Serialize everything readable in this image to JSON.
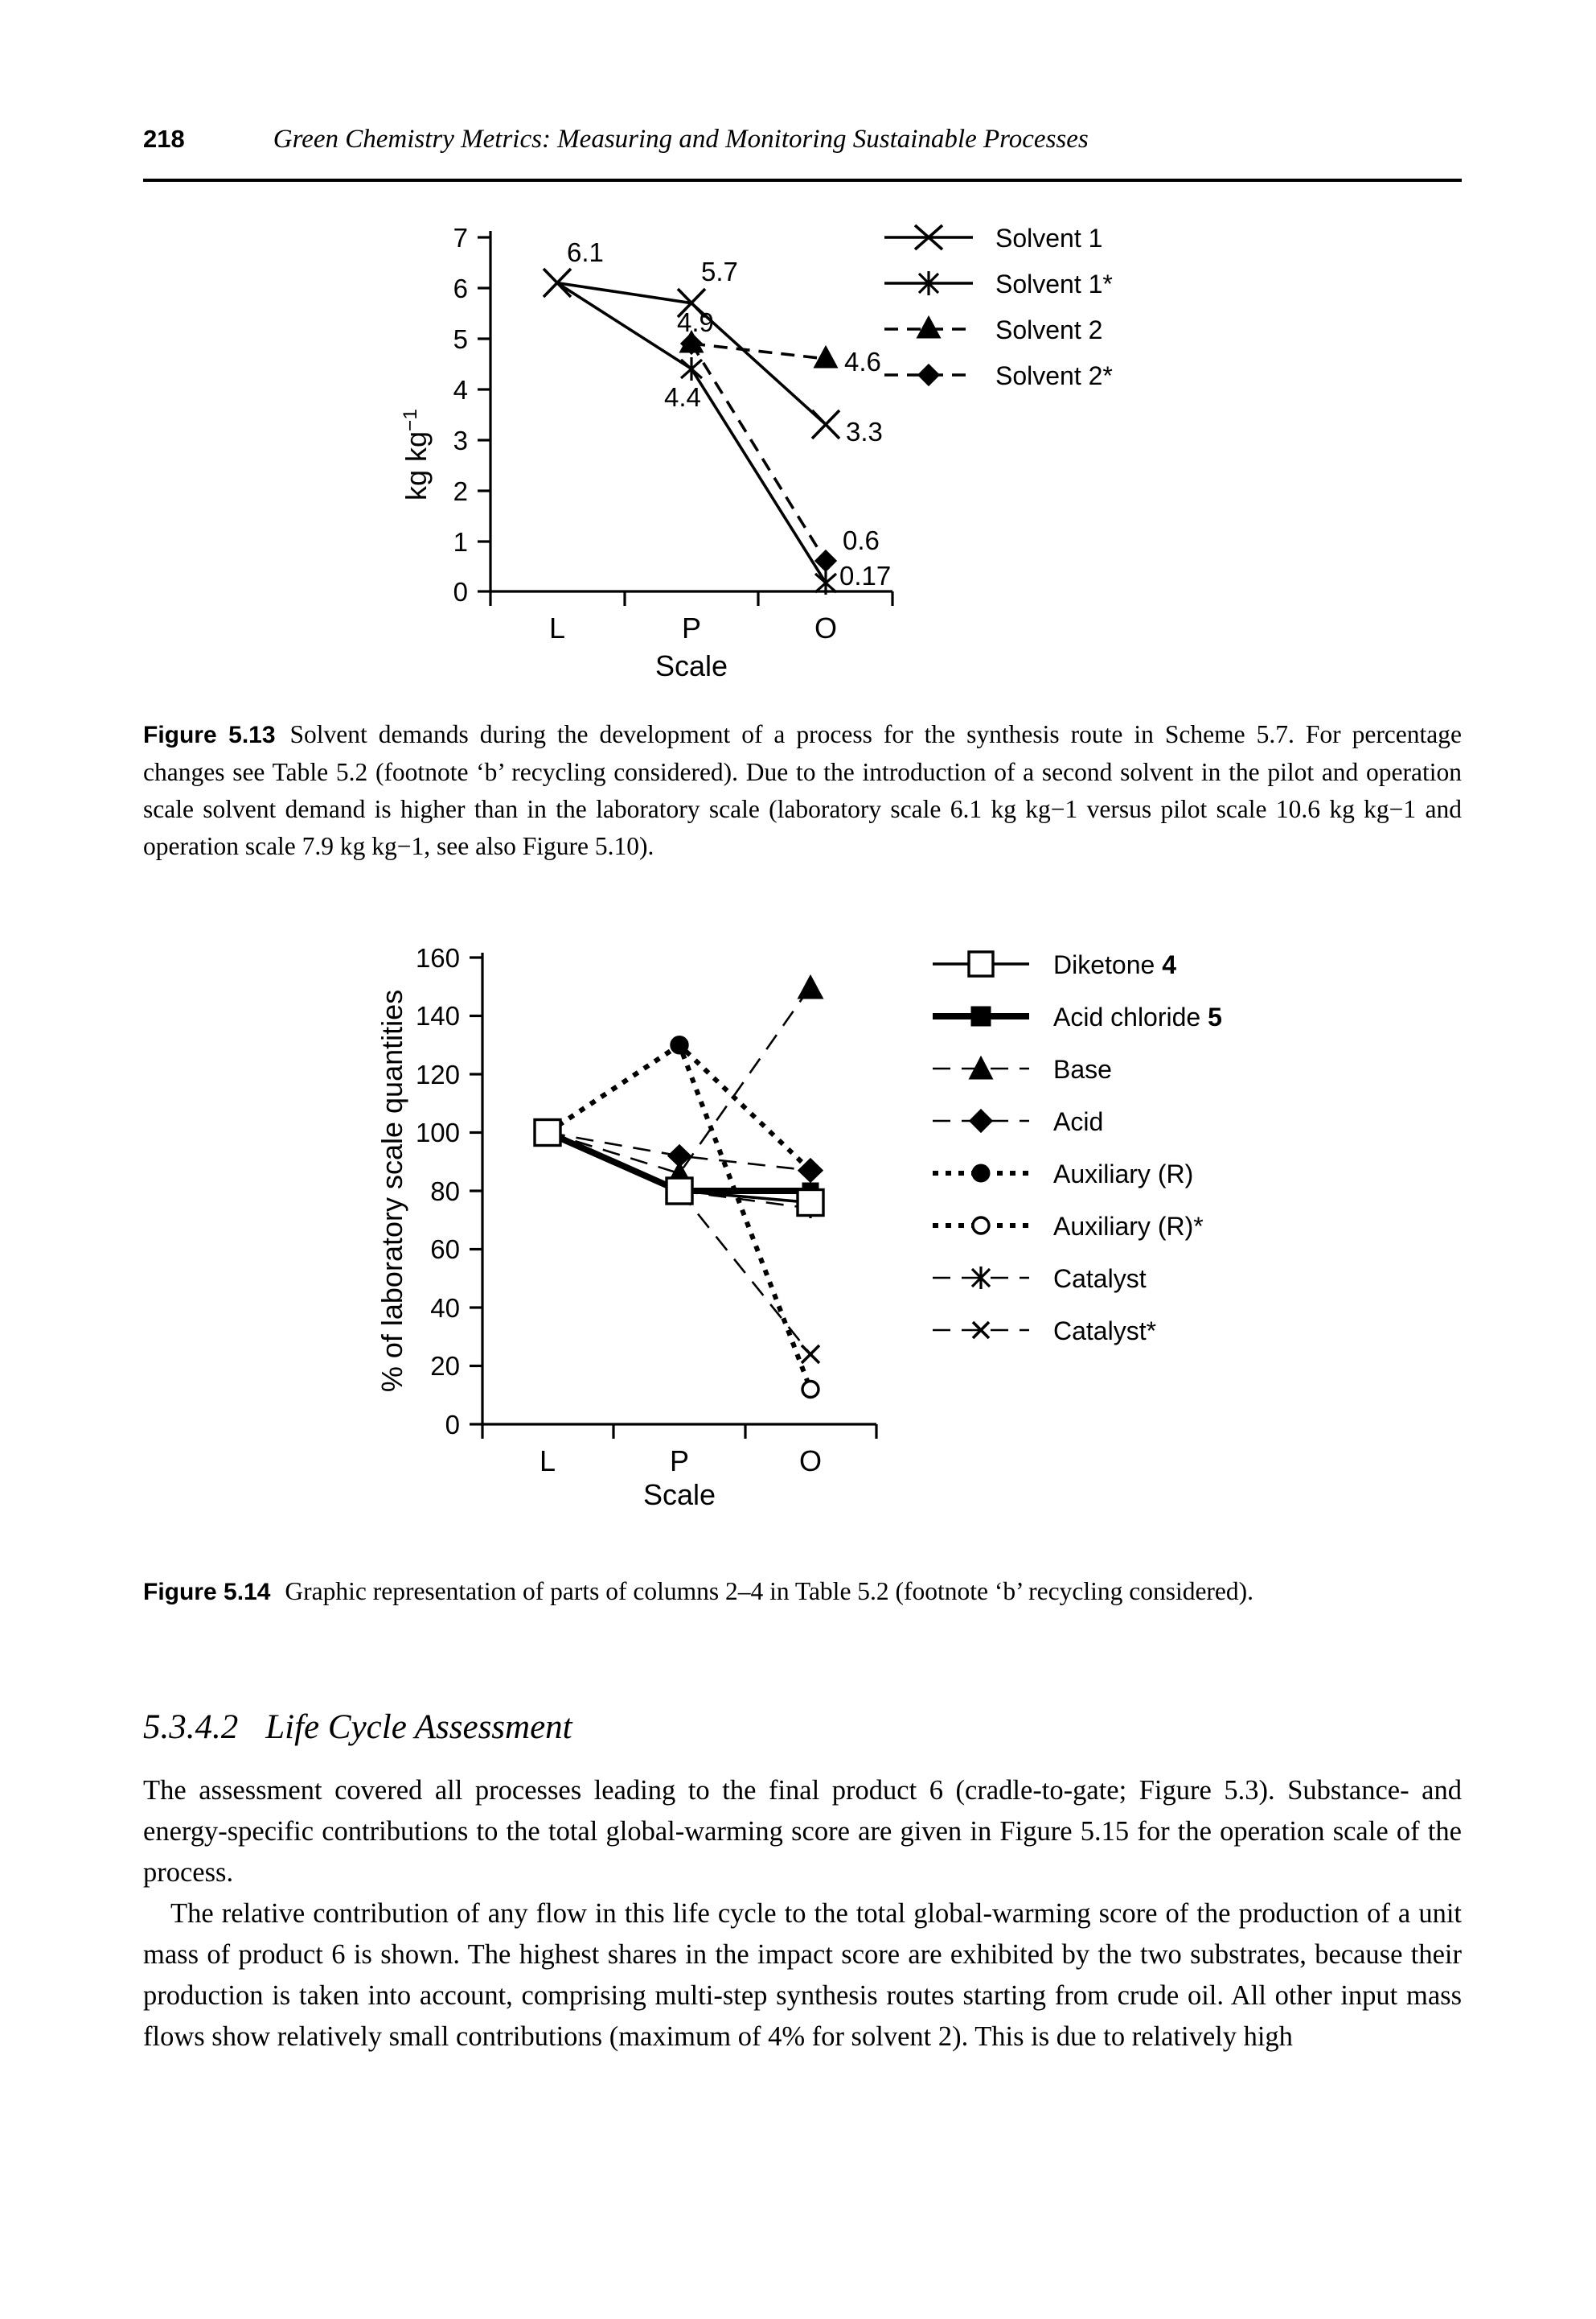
{
  "running_head": {
    "page_number": "218",
    "book_title": "Green Chemistry Metrics: Measuring and Monitoring Sustainable Processes"
  },
  "figure_5_13": {
    "caption_label": "Figure 5.13",
    "caption_text": "Solvent demands during the development of a process for the synthesis route in Scheme 5.7. For percentage changes see Table 5.2 (footnote ‘b’ recycling considered). Due to the introduction of a second solvent in the pilot and operation scale solvent demand is higher than in the laboratory scale (laboratory scale 6.1 kg kg−1 versus pilot scale 10.6 kg kg−1 and operation scale 7.9 kg kg−1, see also Figure 5.10)."
  },
  "figure_5_14": {
    "caption_label": "Figure 5.14",
    "caption_text": "Graphic representation of parts of columns 2–4 in Table 5.2 (footnote ‘b’ recycling considered)."
  },
  "section": {
    "number": "5.3.4.2",
    "title": "Life Cycle Assessment"
  },
  "body_paragraphs": [
    "The assessment covered all processes leading to the final product 6 (cradle-to-gate; Figure 5.3). Substance- and energy-specific contributions to the total global-warming score are given in Figure 5.15 for the operation scale of the process.",
    "The relative contribution of any flow in this life cycle to the total global-warming score of the production of a unit mass of product 6 is shown. The highest shares in the impact score are exhibited by the two substrates, because their production is taken into account, comprising multi-step synthesis routes starting from crude oil. All other input mass flows show relatively small contributions (maximum of 4% for solvent 2). This is due to relatively high"
  ],
  "chart_data": [
    {
      "id": "chart-5-13",
      "type": "line",
      "title": "",
      "xlabel": "Scale",
      "ylabel": "kg kg−1",
      "categories": [
        "L",
        "P",
        "O"
      ],
      "ylim": [
        0,
        7
      ],
      "yticks": [
        0,
        1,
        2,
        3,
        4,
        5,
        6,
        7
      ],
      "grid": false,
      "legend_position": "right",
      "series": [
        {
          "name": "Solvent 1",
          "marker": "x",
          "linestyle": "solid",
          "values": [
            6.1,
            5.7,
            3.3
          ]
        },
        {
          "name": "Solvent 1*",
          "marker": "asterisk",
          "linestyle": "solid",
          "values": [
            6.1,
            4.4,
            0.17
          ]
        },
        {
          "name": "Solvent 2",
          "marker": "triangle",
          "linestyle": "dashed",
          "values": [
            null,
            4.9,
            4.6
          ]
        },
        {
          "name": "Solvent 2*",
          "marker": "diamond",
          "linestyle": "dashed",
          "values": [
            null,
            4.9,
            0.6
          ]
        }
      ],
      "point_labels": [
        {
          "text": "6.1",
          "series": "Solvent 1",
          "category": "L"
        },
        {
          "text": "5.7",
          "series": "Solvent 1",
          "category": "P"
        },
        {
          "text": "4.9",
          "series": "Solvent 2",
          "category": "P"
        },
        {
          "text": "4.4",
          "series": "Solvent 1*",
          "category": "P"
        },
        {
          "text": "4.6",
          "series": "Solvent 2",
          "category": "O"
        },
        {
          "text": "3.3",
          "series": "Solvent 1",
          "category": "O"
        },
        {
          "text": "0.6",
          "series": "Solvent 2*",
          "category": "O"
        },
        {
          "text": "0.17",
          "series": "Solvent 1*",
          "category": "O"
        }
      ]
    },
    {
      "id": "chart-5-14",
      "type": "line",
      "title": "",
      "xlabel": "Scale",
      "ylabel": "% of laboratory scale quantities",
      "categories": [
        "L",
        "P",
        "O"
      ],
      "ylim": [
        0,
        160
      ],
      "yticks": [
        0,
        20,
        40,
        60,
        80,
        100,
        120,
        140,
        160
      ],
      "grid": false,
      "legend_position": "right",
      "series": [
        {
          "name": "Diketone 4",
          "name_bold_suffix": "4",
          "marker": "square-open",
          "linestyle": "solid",
          "values": [
            100,
            80,
            80
          ]
        },
        {
          "name": "Acid chloride 5",
          "name_bold_suffix": "5",
          "marker": "square-filled",
          "linestyle": "solid",
          "values": [
            100,
            80,
            76
          ]
        },
        {
          "name": "Base",
          "marker": "triangle",
          "linestyle": "dashed",
          "values": [
            100,
            86,
            150
          ]
        },
        {
          "name": "Acid",
          "marker": "diamond",
          "linestyle": "dashed",
          "values": [
            100,
            92,
            87
          ]
        },
        {
          "name": "Auxiliary (R)",
          "marker": "circle-filled",
          "linestyle": "dotted",
          "values": [
            100,
            130,
            87
          ]
        },
        {
          "name": "Auxiliary (R)*",
          "marker": "circle-open",
          "linestyle": "dotted",
          "values": [
            100,
            130,
            12
          ]
        },
        {
          "name": "Catalyst",
          "marker": "asterisk",
          "linestyle": "dashed",
          "values": [
            100,
            80,
            74
          ]
        },
        {
          "name": "Catalyst*",
          "marker": "x",
          "linestyle": "dashed",
          "values": [
            100,
            80,
            24
          ]
        }
      ]
    }
  ]
}
